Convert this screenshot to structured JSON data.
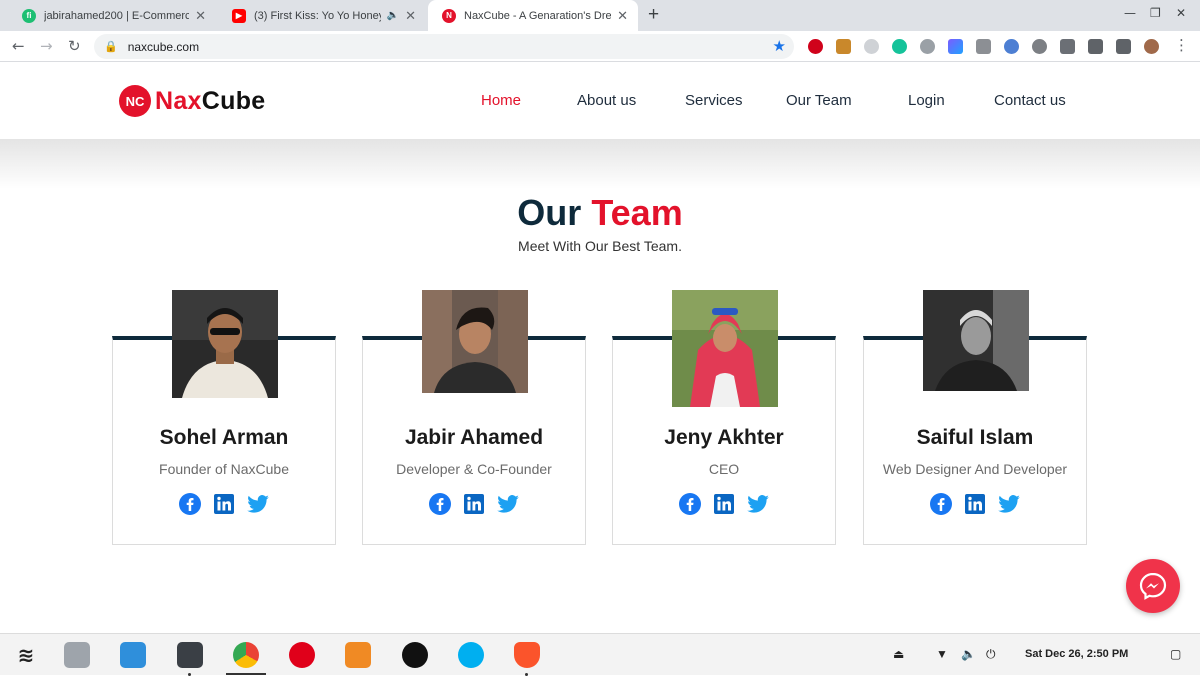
{
  "browser": {
    "tabs": [
      {
        "title": "jabirahamed200 | E-Commerce",
        "favicon": "fiverr-icon",
        "color": "#1dbf73"
      },
      {
        "title": "(3) First Kiss: Yo Yo Honey",
        "favicon": "youtube-icon",
        "color": "#ff0000"
      },
      {
        "title": "NaxCube - A Genaration's Dre",
        "favicon": "naxcube-icon",
        "color": "#e3122b"
      }
    ],
    "new_tab": "+",
    "url": "naxcube.com"
  },
  "site": {
    "logo": {
      "mark": "NC",
      "part1": "Nax",
      "part2": "Cube"
    },
    "nav": [
      "Home",
      "About us",
      "Services",
      "Our Team",
      "Login",
      "Contact us"
    ],
    "active_nav": "Home",
    "colors": {
      "accent": "#e3122b",
      "dark": "#0e2a3b",
      "facebook": "#1877f2",
      "linkedin": "#0a66c2",
      "twitter": "#1da1f2"
    }
  },
  "team": {
    "title_part1": "Our",
    "title_part2": "Team",
    "subtitle": "Meet With Our Best Team.",
    "members": [
      {
        "name": "Sohel Arman",
        "role": "Founder of NaxCube"
      },
      {
        "name": "Jabir Ahamed",
        "role": "Developer & Co-Founder"
      },
      {
        "name": "Jeny Akhter",
        "role": "CEO"
      },
      {
        "name": "Saiful Islam",
        "role": "Web Designer And Developer"
      }
    ]
  },
  "taskbar": {
    "clock": "Sat Dec 26,  2:50 PM"
  }
}
